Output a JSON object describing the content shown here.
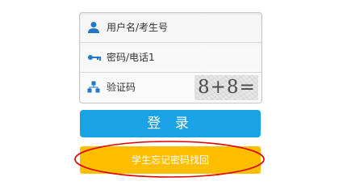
{
  "form": {
    "username_placeholder": "用户名/考生号",
    "password_placeholder": "密码/电话1",
    "captcha_placeholder": "验证码",
    "captcha_image_text": "8+8="
  },
  "actions": {
    "login_label": "登 录",
    "forgot_password_label": "学生忘记密码找回"
  },
  "colors": {
    "login_button": "#19a3e6",
    "forgot_button": "#ffbf00",
    "annotation_circle": "#e00000",
    "icon_blue": "#1f78c8"
  },
  "icons": {
    "username": "user-icon",
    "password": "key-icon",
    "captcha": "captcha-icon"
  }
}
